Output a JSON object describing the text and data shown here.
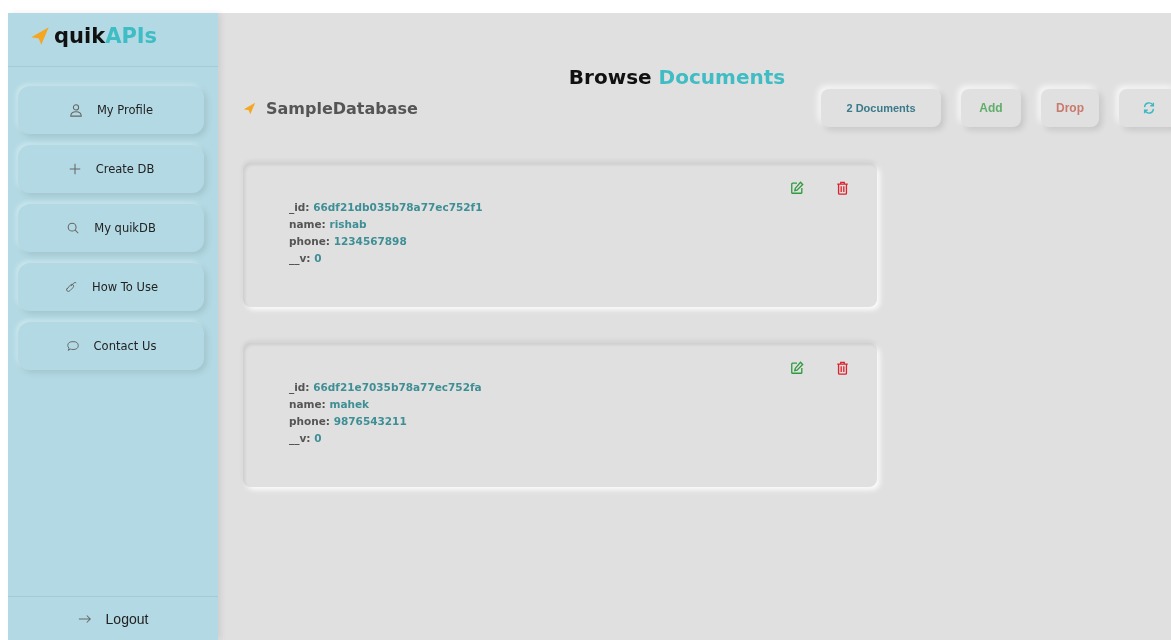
{
  "sidebar": {
    "logo": {
      "lead": "quik",
      "accent": "APIs"
    },
    "items": [
      {
        "label": "My Profile",
        "kind": "user"
      },
      {
        "label": "Create DB",
        "kind": "plus"
      },
      {
        "label": "My quikDB",
        "kind": "search"
      },
      {
        "label": "How To Use",
        "kind": "link"
      },
      {
        "label": "Contact Us",
        "kind": "chat"
      }
    ],
    "logout": {
      "label": "Logout"
    }
  },
  "header": {
    "title_lead": "Browse",
    "title_accent": "Documents",
    "database": "SampleDatabase",
    "buttons": [
      {
        "kind": "count",
        "label": "2 Documents"
      },
      {
        "kind": "add",
        "label": "Add"
      },
      {
        "kind": "drop",
        "label": "Drop"
      },
      {
        "kind": "refresh"
      }
    ]
  },
  "documents": [
    {
      "fields": [
        {
          "key": "_id:",
          "value": "66df21db035b78a77ec752f1"
        },
        {
          "key": "name:",
          "value": "rishab"
        },
        {
          "key": "phone:",
          "value": "1234567898"
        },
        {
          "key": "__v:",
          "value": "0"
        }
      ]
    },
    {
      "fields": [
        {
          "key": "_id:",
          "value": "66df21e7035b78a77ec752fa"
        },
        {
          "key": "name:",
          "value": "mahek"
        },
        {
          "key": "phone:",
          "value": "9876543211"
        },
        {
          "key": "__v:",
          "value": "0"
        }
      ]
    }
  ]
}
